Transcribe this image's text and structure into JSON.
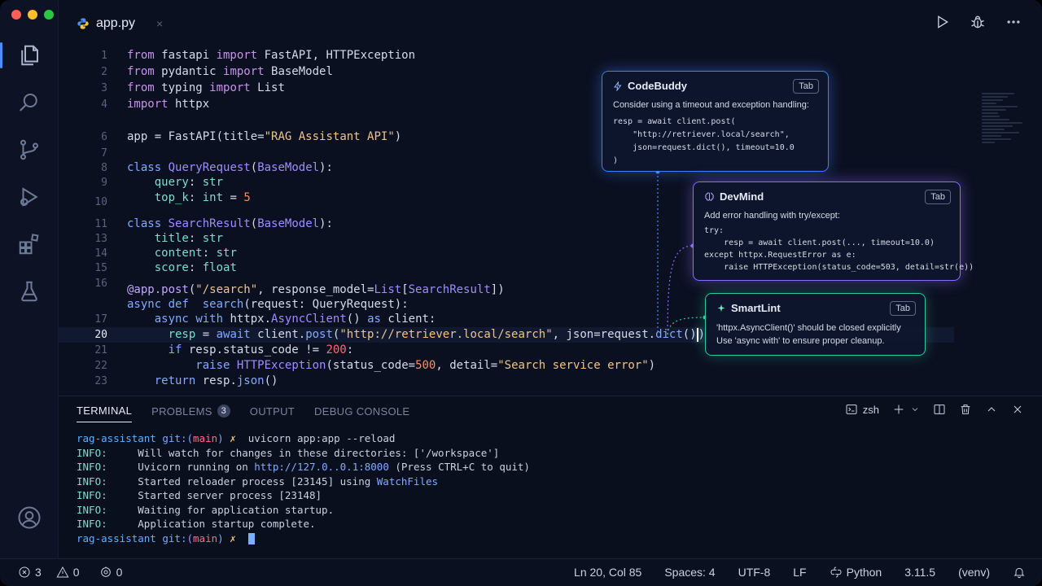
{
  "tab": {
    "filename": "app.py",
    "close": "×"
  },
  "editor": {
    "lines": [
      {
        "n": "1"
      },
      {
        "n": "2"
      },
      {
        "n": "3"
      },
      {
        "n": "4"
      },
      {
        "n": "6"
      },
      {
        "n": "7"
      },
      {
        "n": "8"
      },
      {
        "n": "9"
      },
      {
        "n": "10"
      },
      {
        "n": "11"
      },
      {
        "n": "13"
      },
      {
        "n": "14"
      },
      {
        "n": "15"
      },
      {
        "n": "16"
      },
      {
        "n": "16"
      },
      {
        "n": "17"
      },
      {
        "n": "20"
      },
      {
        "n": "21"
      },
      {
        "n": "22"
      },
      {
        "n": "23"
      }
    ],
    "current_line": "20"
  },
  "cards": {
    "codebuddy": {
      "name": "CodeBuddy",
      "key": "Tab",
      "message": "Consider using a timeout and exception handling:",
      "code": "resp = await client.post(\n    \"http://retriever.local/search\",\n    json=request.dict(), timeout=10.0\n)",
      "color": "#3f7fff"
    },
    "devmind": {
      "name": "DevMind",
      "key": "Tab",
      "message": "Add error handling with try/except:",
      "code": "try:\n    resp = await client.post(..., timeout=10.0)\nexcept httpx.RequestError as e:\n    raise HTTPException(status_code=503, detail=str(e))",
      "color": "#8b6cff"
    },
    "smartlint": {
      "name": "SmartLint",
      "key": "Tab",
      "message1": "'httpx.AsyncClient()' should be closed explicitly",
      "message2": "Use 'async with' to ensure proper cleanup.",
      "color": "#2ec99a"
    }
  },
  "panel": {
    "tabs": {
      "terminal": "TERMINAL",
      "problems": "PROBLEMS",
      "problems_count": "3",
      "output": "OUTPUT",
      "debug": "DEBUG CONSOLE"
    },
    "shell": "zsh",
    "terminal": {
      "repo": "rag-assistant",
      "git": "git:(",
      "branch": "main",
      "git_close": ")",
      "x": "✗",
      "command": "uvicorn app:app --reload",
      "info": "INFO:",
      "l1": "Will watch for changes in these directories: ['/workspace']",
      "l2a": "Uvicorn running on ",
      "l2link": "http://127.0..0.1:8000",
      "l2b": " (Press CTRL+C to quit)",
      "l3a": "Started reloader process [23145] using ",
      "l3link": "WatchFiles",
      "l4": "Started server process [23148]",
      "l5": "Waiting for application startup.",
      "l6": "Application startup complete."
    }
  },
  "status": {
    "errors": "3",
    "warnings": "0",
    "ports": "0",
    "position": "Ln 20, Col 85",
    "spaces": "Spaces: 4",
    "encoding": "UTF-8",
    "eol": "LF",
    "language": "Python",
    "version": "3.11.5",
    "env": "(venv)"
  }
}
